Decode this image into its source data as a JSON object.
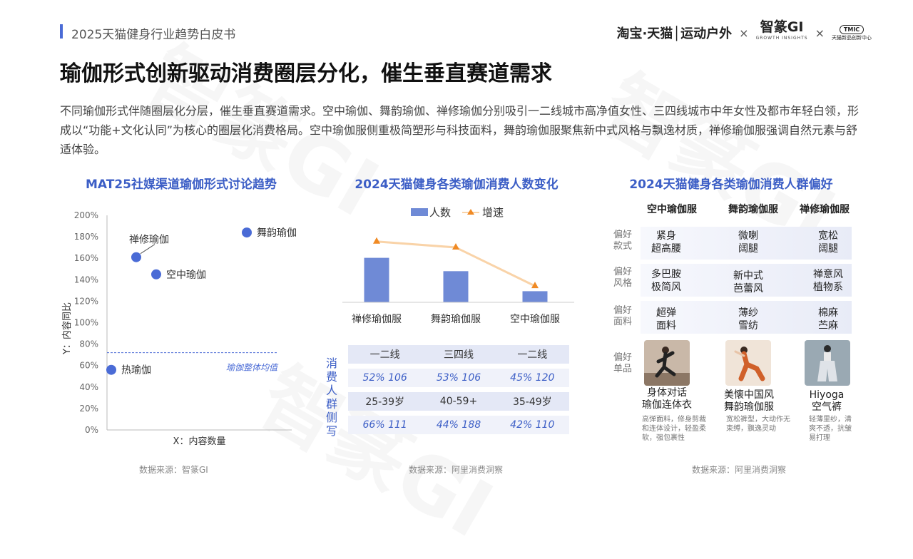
{
  "header": {
    "report_title": "2025天猫健身行业趋势白皮书",
    "logo_taobao": "淘宝·天猫│运动户外",
    "logo_sep1": "×",
    "logo_zz": "智篆GI",
    "logo_zz_sub": "GROWTH INSIGHTS",
    "logo_sep2": "×",
    "logo_tmic": "TMIC",
    "logo_tmic_sub": "天猫新品创新中心"
  },
  "page_title": "瑜伽形式创新驱动消费圈层分化，催生垂直赛道需求",
  "description": "不同瑜伽形式伴随圈层化分层，催生垂直赛道需求。空中瑜伽、舞韵瑜伽、禅修瑜伽分别吸引一二线城市高净值女性、三四线城市中年女性及都市年轻白领，形成以“功能+文化认同”为核心的圈层化消费格局。空中瑜伽服侧重极简塑形与科技面料，舞韵瑜伽服聚焦新中式风格与飘逸材质，禅修瑜伽服强调自然元素与舒适体验。",
  "panel1": {
    "title": "MAT25社媒渠道瑜伽形式讨论趋势",
    "source": "数据来源：智篆GI"
  },
  "panel2": {
    "title": "2024天猫健身各类瑜伽消费人数变化",
    "source": "数据来源：阿里消费洞察",
    "side_label": "消费人群侧写",
    "table": {
      "cities": [
        "一二线",
        "三四线",
        "一二线"
      ],
      "city_vals": [
        "52% 106",
        "53% 106",
        "45% 120"
      ],
      "ages": [
        "25-39岁",
        "40-59+",
        "35-49岁"
      ],
      "age_vals": [
        "66% 111",
        "44% 188",
        "42% 110"
      ]
    }
  },
  "panel3": {
    "title": "2024天猫健身各类瑜伽消费人群偏好",
    "source": "数据来源：阿里消费洞察",
    "columns": [
      "空中瑜伽服",
      "舞韵瑜伽服",
      "禅修瑜伽服"
    ],
    "rows": [
      {
        "label": "偏好款式",
        "cells": [
          "紧身\n超高腰",
          "微喇\n阔腿",
          "宽松\n阔腿"
        ]
      },
      {
        "label": "偏好风格",
        "cells": [
          "多巴胺\n极简风",
          "新中式\n芭蕾风",
          "禅意风\n植物系"
        ]
      },
      {
        "label": "偏好面料",
        "cells": [
          "超弹\n面料",
          "薄纱\n雪纺",
          "棉麻\n苎麻"
        ]
      }
    ],
    "products_label": "偏好单品",
    "products": [
      {
        "name": "身体对话\n瑜伽连体衣",
        "desc": "高弹面料，修身剪裁和连体设计，轻盈柔软，强包裹性"
      },
      {
        "name": "美懐中国风\n舞韵瑜伽服",
        "desc": "宽松裤型，大动作无束缚，飘逸灵动"
      },
      {
        "name": "Hiyoga\n空气裤",
        "desc": "轻薄里纱，清爽不透，抗皱易打理"
      }
    ]
  },
  "chart_data": [
    {
      "type": "scatter",
      "title": "MAT25社媒渠道瑜伽形式讨论趋势",
      "xlabel": "X：内容数量",
      "ylabel": "Y：内容同比",
      "ylim": [
        0,
        200
      ],
      "y_ticks": [
        "0%",
        "20%",
        "40%",
        "60%",
        "80%",
        "100%",
        "120%",
        "140%",
        "160%",
        "180%",
        "200%"
      ],
      "points": [
        {
          "label": "舞韵瑜伽",
          "y": 184,
          "x_rank": 4
        },
        {
          "label": "禅修瑜伽",
          "y": 161,
          "x_rank": 2
        },
        {
          "label": "空中瑜伽",
          "y": 145,
          "x_rank": 3
        },
        {
          "label": "热瑜伽",
          "y": 56,
          "x_rank": 1
        }
      ],
      "reference_line": {
        "label": "瑜伽整体均值",
        "y": 72
      },
      "color": "#4a6bd6"
    },
    {
      "type": "bar",
      "title": "2024天猫健身各类瑜伽消费人数变化",
      "categories": [
        "禅修瑜伽服",
        "舞韵瑜伽服",
        "空中瑜伽服"
      ],
      "series": [
        {
          "name": "人数",
          "values": [
            60,
            42,
            15
          ],
          "color": "#6f8ad6"
        },
        {
          "name": "增速",
          "values": [
            82,
            74,
            22
          ],
          "color": "#f08a24",
          "line_color": "#f9d3a8"
        }
      ],
      "legend": "top-center"
    }
  ]
}
